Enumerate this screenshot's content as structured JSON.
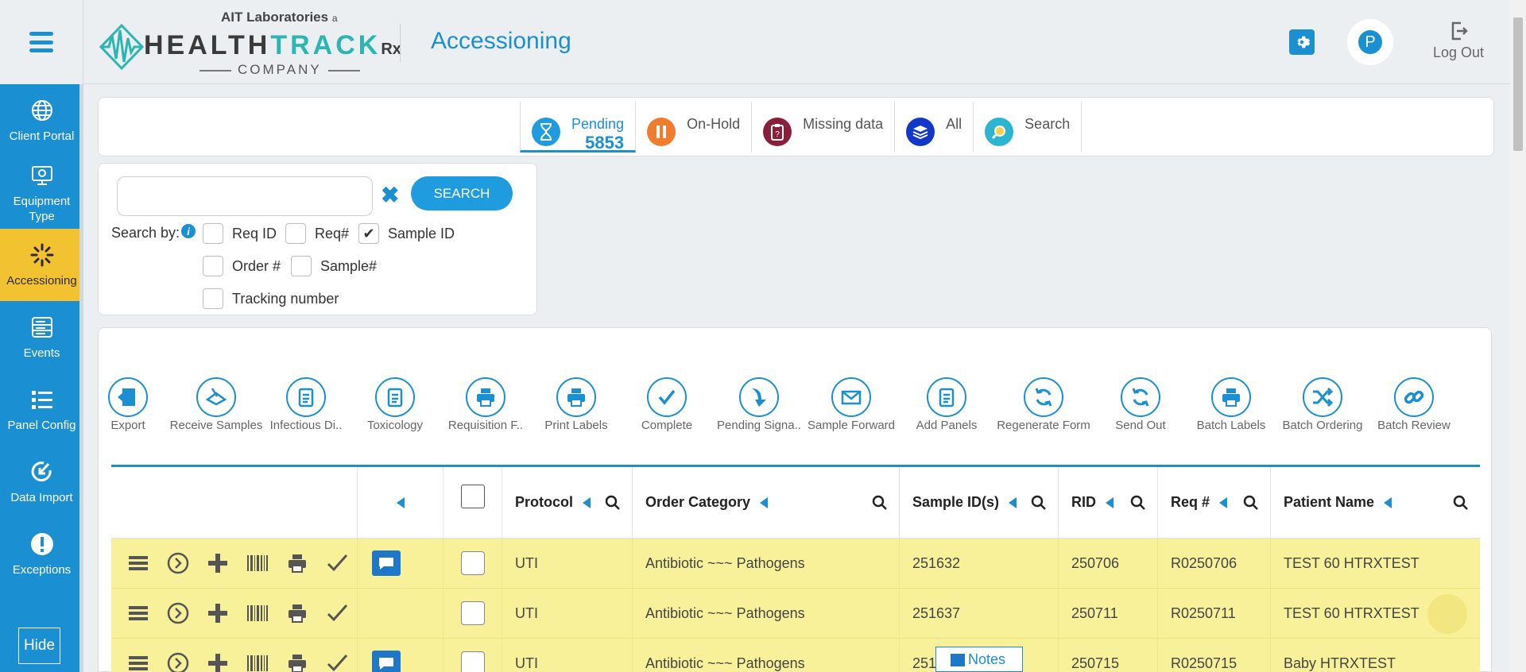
{
  "header": {
    "logo_top": "AIT Laboratories",
    "logo_top_suffix": "a",
    "logo_brand_a": "HEALTH",
    "logo_brand_b": "TRACK",
    "logo_brand_c": "Rx",
    "logo_company": "COMPANY",
    "page_title": "Accessioning",
    "avatar_initial": "P",
    "logout_label": "Log Out"
  },
  "sidebar": {
    "items": [
      {
        "label": "Client Portal",
        "icon": "globe-icon"
      },
      {
        "label": "Equipment Type",
        "icon": "monitor-icon"
      },
      {
        "label": "Accessioning",
        "icon": "spinner-icon",
        "active": true
      },
      {
        "label": "Events",
        "icon": "server-icon"
      },
      {
        "label": "Panel Config",
        "icon": "list-icon"
      },
      {
        "label": "Data Import",
        "icon": "import-icon"
      },
      {
        "label": "Exceptions",
        "icon": "alert-icon"
      }
    ],
    "hide_label": "Hide"
  },
  "status_tabs": [
    {
      "label": "Pending",
      "count": "5853",
      "color": "#1f9ce0",
      "active": true
    },
    {
      "label": "On-Hold",
      "color": "#f07d2e"
    },
    {
      "label": "Missing data",
      "color": "#8b1f3a"
    },
    {
      "label": "All",
      "color": "#1238c9"
    },
    {
      "label": "Search",
      "color": "#2bb5cf"
    }
  ],
  "search": {
    "placeholder": "",
    "button_label": "SEARCH",
    "search_by_label": "Search by:",
    "options": [
      {
        "label": "Req ID",
        "checked": false
      },
      {
        "label": "Req#",
        "checked": false
      },
      {
        "label": "Sample ID",
        "checked": true
      },
      {
        "label": "Order #",
        "checked": false
      },
      {
        "label": "Sample#",
        "checked": false
      },
      {
        "label": "Tracking number",
        "checked": false
      }
    ]
  },
  "toolbar": [
    {
      "label": "Export",
      "icon": "export-icon"
    },
    {
      "label": "Receive Samples",
      "icon": "receive-icon"
    },
    {
      "label": "Infectious Di..",
      "icon": "clipboard-icon"
    },
    {
      "label": "Toxicology",
      "icon": "clipboard-icon"
    },
    {
      "label": "Requisition F..",
      "icon": "printer-icon"
    },
    {
      "label": "Print Labels",
      "icon": "printer-icon"
    },
    {
      "label": "Complete",
      "icon": "check-icon"
    },
    {
      "label": "Pending Signa..",
      "icon": "arrow-down-icon"
    },
    {
      "label": "Sample Forward",
      "icon": "mail-icon"
    },
    {
      "label": "Add Panels",
      "icon": "clipboard-icon"
    },
    {
      "label": "Regenerate Form",
      "icon": "refresh-icon"
    },
    {
      "label": "Send Out",
      "icon": "refresh-icon"
    },
    {
      "label": "Batch Labels",
      "icon": "printer-icon"
    },
    {
      "label": "Batch Ordering",
      "icon": "shuffle-icon"
    },
    {
      "label": "Batch Review",
      "icon": "link-icon"
    }
  ],
  "table": {
    "headers": {
      "protocol": "Protocol",
      "order_category": "Order Category",
      "sample_ids": "Sample ID(s)",
      "rid": "RID",
      "req_no": "Req #",
      "patient_name": "Patient Name"
    },
    "rows": [
      {
        "has_note": true,
        "protocol": "UTI",
        "order_category": "Antibiotic ~~~ Pathogens",
        "sample_id": "251632",
        "rid": "250706",
        "req_no": "R0250706",
        "patient": "TEST 60 HTRXTEST"
      },
      {
        "has_note": false,
        "protocol": "UTI",
        "order_category": "Antibiotic ~~~ Pathogens",
        "sample_id": "251637",
        "rid": "250711",
        "req_no": "R0250711",
        "patient": "TEST 60 HTRXTEST"
      },
      {
        "has_note": true,
        "protocol": "UTI",
        "order_category": "Antibiotic ~~~ Pathogens",
        "sample_id": "25164",
        "rid": "250715",
        "req_no": "R0250715",
        "patient": "Baby HTRXTEST"
      }
    ]
  },
  "notes_tooltip": "Notes",
  "colors": {
    "primary": "#1a8fd1",
    "active_nav": "#f2c230",
    "row_highlight": "#f9f19a"
  }
}
